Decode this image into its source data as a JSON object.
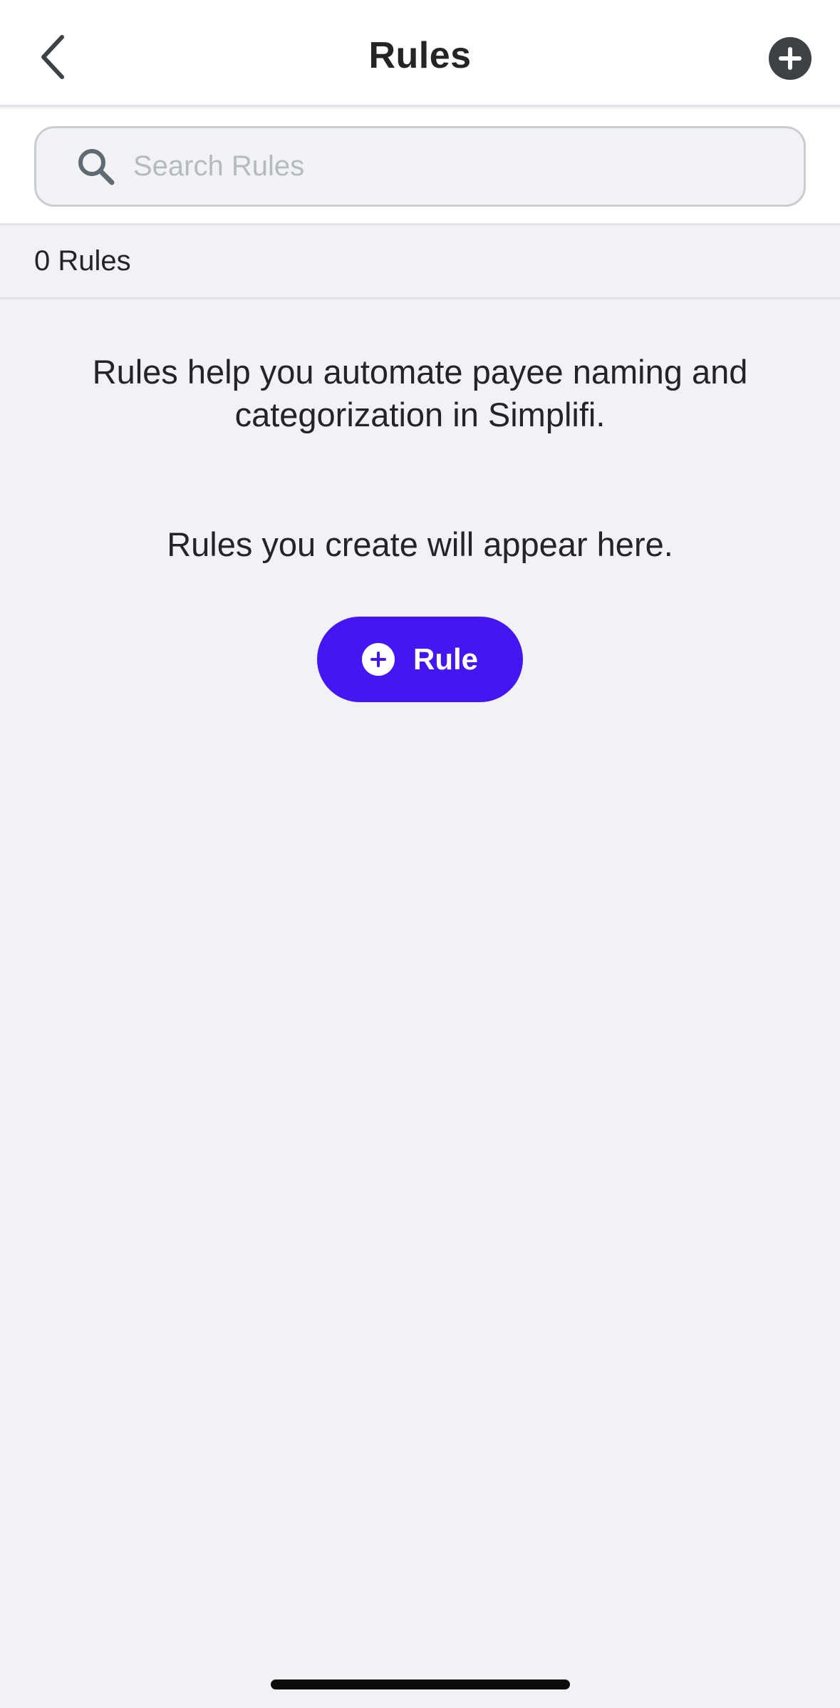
{
  "header": {
    "title": "Rules",
    "back_icon": "chevron-left-icon",
    "add_icon": "plus-circle-icon"
  },
  "search": {
    "placeholder": "Search Rules",
    "value": "",
    "icon": "search-icon"
  },
  "count": {
    "label": "0 Rules"
  },
  "empty_state": {
    "intro": "Rules help you automate payee naming and categorization in Simplifi.",
    "message": "Rules you create will appear here.",
    "button_label": "Rule",
    "button_icon": "plus-circle-icon"
  },
  "colors": {
    "accent": "#4316f2",
    "header_button": "#3d4246",
    "background": "#f1f2f5"
  }
}
